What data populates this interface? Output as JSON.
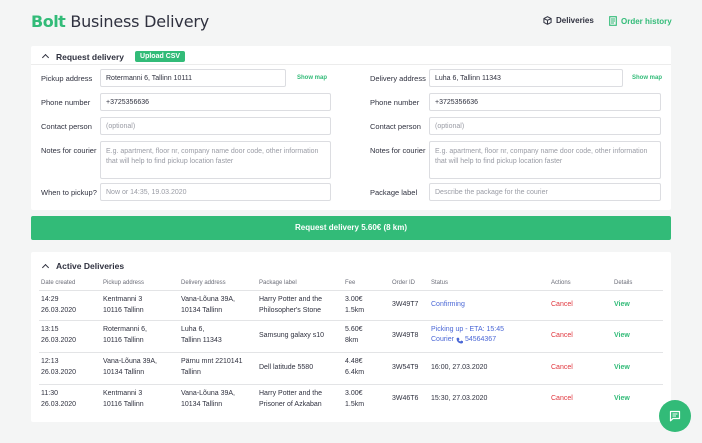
{
  "header": {
    "logo": "Bolt",
    "title": "Business Delivery",
    "nav_deliveries": "Deliveries",
    "nav_order_history": "Order history"
  },
  "request": {
    "title": "Request delivery",
    "upload_csv": "Upload CSV",
    "pickup_address_label": "Pickup address",
    "pickup_address_value": "Rotermanni 6, Tallinn 10111",
    "delivery_address_label": "Delivery address",
    "delivery_address_value": "Luha 6, Tallinn 11343",
    "show_map": "Show map",
    "pickup_phone_label": "Phone number",
    "pickup_phone_value": "+3725356636",
    "delivery_phone_label": "Phone number",
    "delivery_phone_value": "+3725356636",
    "pickup_contact_label": "Contact person",
    "delivery_contact_label": "Contact person",
    "contact_placeholder": "(optional)",
    "pickup_notes_label": "Notes for courier",
    "pickup_notes_placeholder": "E.g. apartment, floor nr, company name  door code, other information that will help to find pickup location faster",
    "delivery_notes_label": "Notes for courier",
    "delivery_notes_placeholder": "E.g. apartment, floor nr, company name  door code, other information that will help to find pickup location faster",
    "when_label": "When to pickup?",
    "when_placeholder": "Now or 14:35, 19.03.2020",
    "package_label": "Package label",
    "package_placeholder": "Describe the package for the courier",
    "submit": "Request delivery 5.60€ (8 km)"
  },
  "active": {
    "title": "Active Deliveries",
    "columns": [
      "Date created",
      "Pickup address",
      "Delivery address",
      "Package label",
      "Fee",
      "Order ID",
      "Status",
      "Actions",
      "Details"
    ],
    "rows": [
      {
        "date": "14:29\n26.03.2020",
        "pickup": "Kentmanni 3\n10116 Tallinn",
        "delivery": "Vana-Lõuna 39A,\n10134 Tallinn",
        "package": "Harry Potter and the\nPhilosopher's Stone",
        "fee": "3.00€\n1.5km",
        "order_id": "3W49T7",
        "status": "Confirming",
        "action": "Cancel",
        "details": "View"
      },
      {
        "date": "13:15\n26.03.2020",
        "pickup": "Rotermanni 6,\n10116 Tallinn",
        "delivery": "Luha 6,\nTallinn 11343",
        "package": "Samsung galaxy s10",
        "fee": "5.60€\n8km",
        "order_id": "3W49T8",
        "status": "Picking up - ETA: 15:45",
        "status_courier": "Courier",
        "status_phone": "54564367",
        "action": "Cancel",
        "details": "View"
      },
      {
        "date": "12:13\n26.03.2020",
        "pickup": "Vana-Lõuna 39A,\n10134 Tallinn",
        "delivery": "Pärnu mnt 2210141\nTallinn",
        "package": "Dell latitude 5580",
        "fee": "4.48€\n6.4km",
        "order_id": "3W54T9",
        "status": "16:00, 27.03.2020",
        "action": "Cancel",
        "details": "View"
      },
      {
        "date": "11:30\n26.03.2020",
        "pickup": "Kentmanni 3\n10116 Tallinn",
        "delivery": "Vana-Lõuna 39A,\n10134 Tallinn",
        "package": "Harry Potter and the\nPrisoner of Azkaban",
        "fee": "3.00€\n1.5km",
        "order_id": "3W46T6",
        "status": "15:30, 27.03.2020",
        "action": "Cancel",
        "details": "View"
      }
    ]
  },
  "colors": {
    "accent": "#32bb78",
    "danger": "#e0343c",
    "link": "#4a67d6"
  },
  "icons": {
    "deliveries": "cube-icon",
    "history": "document-icon",
    "chat": "chat-icon",
    "phone": "phone-icon",
    "chevron": "chevron-up-icon"
  }
}
